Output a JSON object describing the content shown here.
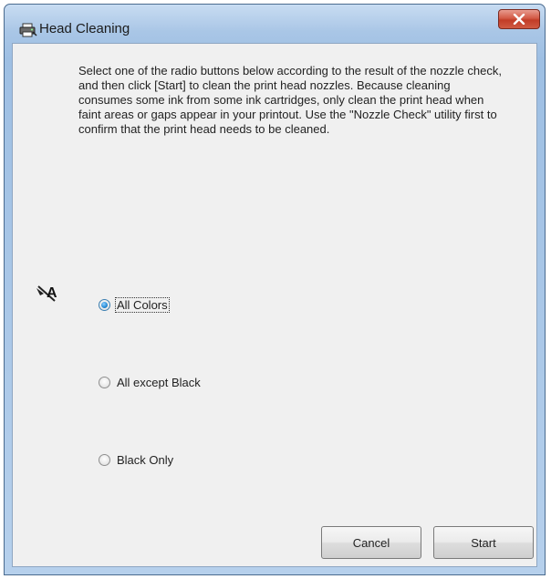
{
  "window": {
    "title": "Head Cleaning",
    "app_icon": "printer-icon",
    "close_icon": "close-icon"
  },
  "instructions": "Select one of the radio buttons below according to the result of the nozzle check, and then click [Start] to clean the print head nozzles. Because cleaning consumes some ink from some ink cartridges, only clean the print head when faint areas or gaps appear in your printout. Use the \"Nozzle Check\" utility first to confirm that the print head needs to be cleaned.",
  "options": [
    {
      "label": "All Colors",
      "checked": true
    },
    {
      "label": "All except Black",
      "checked": false
    },
    {
      "label": "Black Only",
      "checked": false
    }
  ],
  "buttons": {
    "cancel_label": "Cancel",
    "start_label": "Start"
  },
  "colors": {
    "titlebar": "#a9c6e6",
    "client": "#f0f0f0",
    "close": "#c23c27",
    "radio_selected": "#2c8fd8"
  }
}
